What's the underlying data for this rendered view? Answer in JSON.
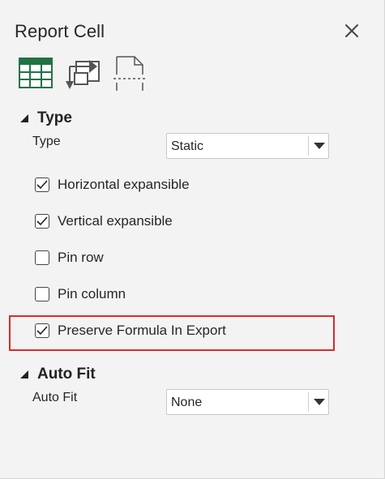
{
  "panel": {
    "title": "Report Cell",
    "close_icon": "close-icon"
  },
  "toolbar": {
    "icons": [
      "table-grid-icon",
      "swap-arrows-icon",
      "page-break-icon"
    ],
    "accent_color": "#217346"
  },
  "type_section": {
    "header": "Type",
    "field_label": "Type",
    "select_value": "Static",
    "checkboxes": [
      {
        "label": "Horizontal expansible",
        "checked": true
      },
      {
        "label": "Vertical expansible",
        "checked": true
      },
      {
        "label": "Pin row",
        "checked": false
      },
      {
        "label": "Pin column",
        "checked": false
      },
      {
        "label": "Preserve Formula In Export",
        "checked": true
      }
    ]
  },
  "autofit_section": {
    "header": "Auto Fit",
    "field_label": "Auto Fit",
    "select_value": "None"
  },
  "highlight_color": "#d92b2b"
}
